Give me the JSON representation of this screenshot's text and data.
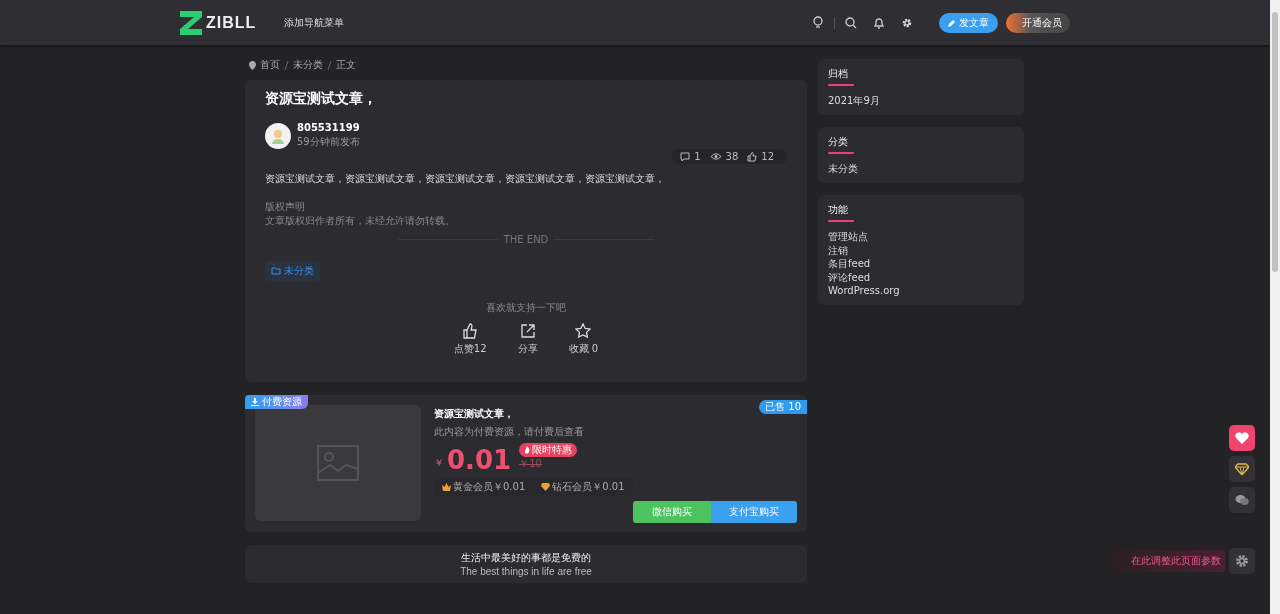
{
  "header": {
    "logo": "ZIBLL",
    "nav": [
      "添加导航菜单"
    ],
    "write_button": "发文章",
    "vip_button": "开通会员"
  },
  "breadcrumb": [
    "首页",
    "未分类",
    "正文"
  ],
  "article": {
    "title": "资源宝测试文章，",
    "author": "805531199",
    "time": "59分钟前发布",
    "stats": {
      "comments": "1",
      "views": "38",
      "likes": "12"
    },
    "body": "资源宝测试文章，资源宝测试文章，资源宝测试文章，资源宝测试文章，资源宝测试文章，",
    "copyright_title": "版权声明",
    "copyright_text": "文章版权归作者所有，未经允许请勿转载。",
    "end": "THE END",
    "tag": "未分类",
    "support": "喜欢就支持一下吧",
    "actions": [
      {
        "kind": "like",
        "label": "点赞12"
      },
      {
        "kind": "share",
        "label": "分享"
      },
      {
        "kind": "favorite",
        "label": "收藏 0"
      }
    ]
  },
  "paid": {
    "badge": "付费资源",
    "sold": "已售 10",
    "title": "资源宝测试文章，",
    "desc": "此内容为付费资源，请付费后查看",
    "currency": "￥",
    "price": "0.01",
    "promo": "限时特惠",
    "original": "￥10",
    "member_prices": [
      {
        "kind": "gold",
        "text": "黄金会员￥0.01"
      },
      {
        "kind": "diamond",
        "text": "钻石会员￥0.01"
      }
    ],
    "buttons": [
      {
        "kind": "wechat",
        "label": "微信购买"
      },
      {
        "kind": "alipay",
        "label": "支付宝购买"
      }
    ]
  },
  "footer_quote": {
    "text": "生活中最美好的事都是免费的",
    "translation": "The best things in life are free"
  },
  "sidebar": [
    {
      "title": "归档",
      "items": [
        "2021年9月"
      ]
    },
    {
      "title": "分类",
      "items": [
        "未分类"
      ]
    },
    {
      "title": "功能",
      "items": [
        "管理站点",
        "注销",
        "条目feed",
        "评论feed",
        "WordPress.org"
      ]
    }
  ],
  "float_buttons": [
    {
      "kind": "heart",
      "selected": true
    },
    {
      "kind": "diamond",
      "selected": false
    },
    {
      "kind": "wechat",
      "selected": false
    }
  ],
  "settings_tip": "在此调整此页面参数"
}
